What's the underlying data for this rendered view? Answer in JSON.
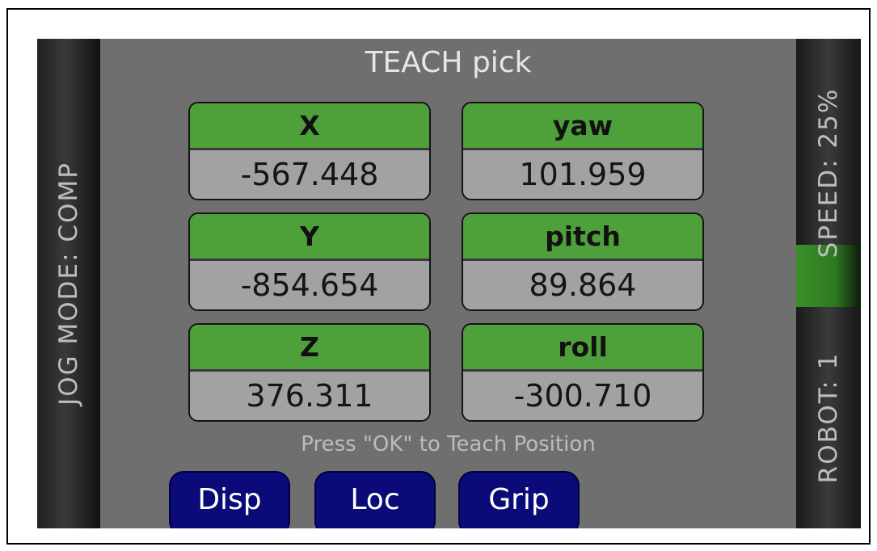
{
  "title": "TEACH pick",
  "left_bar": {
    "label": "JOG MODE: COMP"
  },
  "right_bar": {
    "speed_label": "SPEED: 25%",
    "robot_label": "ROBOT: 1",
    "speed_highlight_color": "#3a8f2a"
  },
  "fields": [
    {
      "label": "X",
      "value": "-567.448"
    },
    {
      "label": "yaw",
      "value": "101.959"
    },
    {
      "label": "Y",
      "value": "-854.654"
    },
    {
      "label": "pitch",
      "value": "89.864"
    },
    {
      "label": "Z",
      "value": "376.311"
    },
    {
      "label": "roll",
      "value": "-300.710"
    }
  ],
  "hint": "Press \"OK\" to Teach Position",
  "buttons": {
    "disp": "Disp",
    "loc": "Loc",
    "grip": "Grip"
  },
  "colors": {
    "header_green": "#4ea03a",
    "button_blue": "#0a0a78",
    "screen_gray": "#6f6f6f"
  }
}
